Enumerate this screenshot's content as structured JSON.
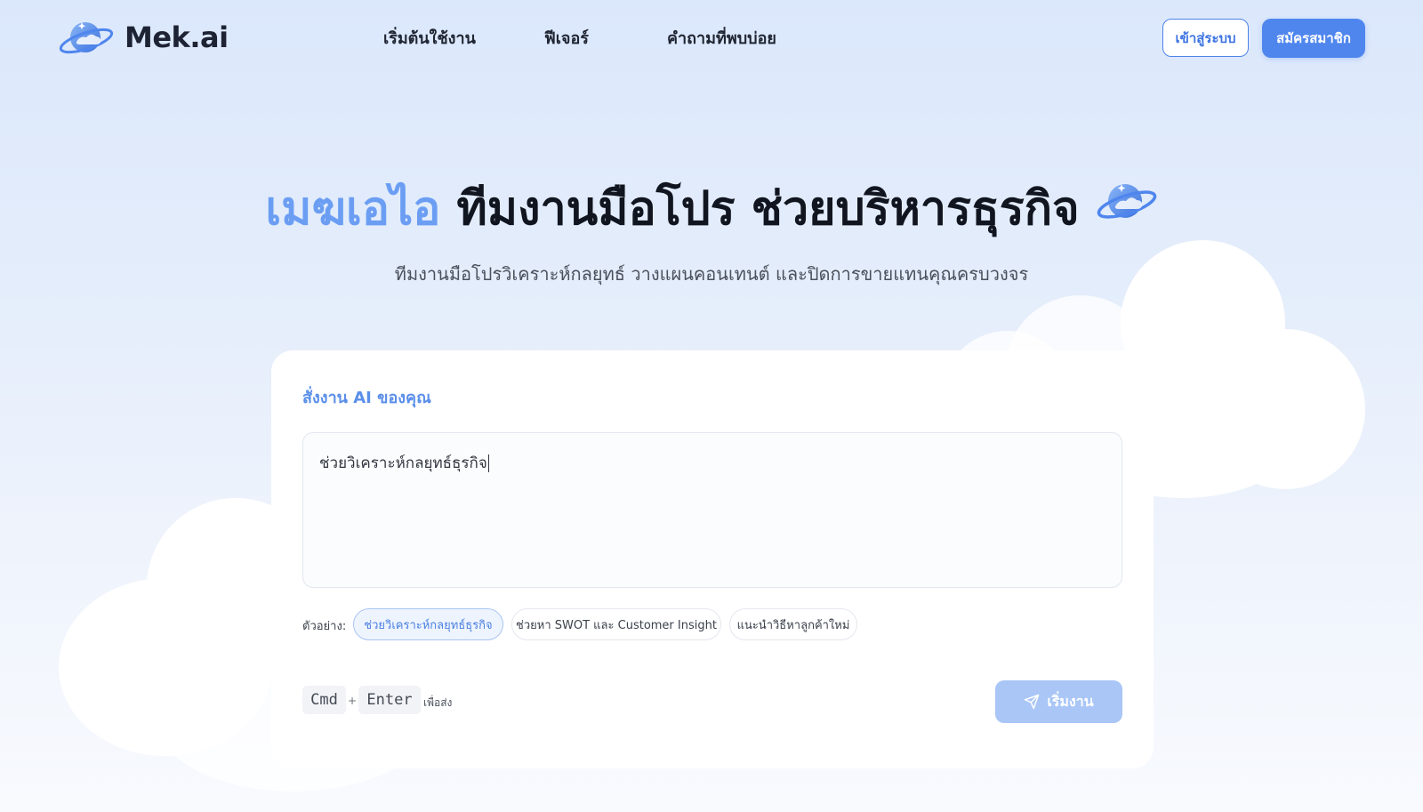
{
  "header": {
    "brand": "Mek.ai",
    "nav": [
      {
        "label": "เริ่มต้นใช้งาน"
      },
      {
        "label": "ฟีเจอร์"
      },
      {
        "label": "คำถามที่พบบ่อย"
      }
    ],
    "login_label": "เข้าสู่ระบบ",
    "signup_label": "สมัครสมาชิก"
  },
  "hero": {
    "brand_word": "เมฆเอไอ",
    "title_rest": "ทีมงานมือโปร ช่วยบริหารธุรกิจ",
    "subtitle": "ทีมงานมือโปรวิเคราะห์กลยุทธ์ วางแผนคอนเทนต์ และปิดการขายแทนคุณครบวงจร"
  },
  "card": {
    "label": "สั่งงาน AI ของคุณ",
    "prompt_value": "ช่วยวิเคราะห์กลยุทธ์ธุรกิจ",
    "examples_label": "ตัวอย่าง:",
    "examples": [
      {
        "label": "ช่วยวิเคราะห์กลยุทธ์ธุรกิจ",
        "active": true
      },
      {
        "label": "ช่วยหา SWOT และ Customer Insight",
        "active": false
      },
      {
        "label": "แนะนำวิธีหาลูกค้าใหม่",
        "active": false
      }
    ],
    "shortcut_key1": "Cmd",
    "shortcut_plus": "+",
    "shortcut_key2": "Enter",
    "shortcut_hint": "เพื่อส่ง",
    "start_label": "เริ่มงาน"
  },
  "icons": {
    "logo": "planet-logo-icon",
    "hero": "planet-icon",
    "start": "send-icon"
  },
  "colors": {
    "accent": "#4f86ee",
    "brand_word": "#6b9ef3",
    "start_button": "#a9c6f6"
  }
}
